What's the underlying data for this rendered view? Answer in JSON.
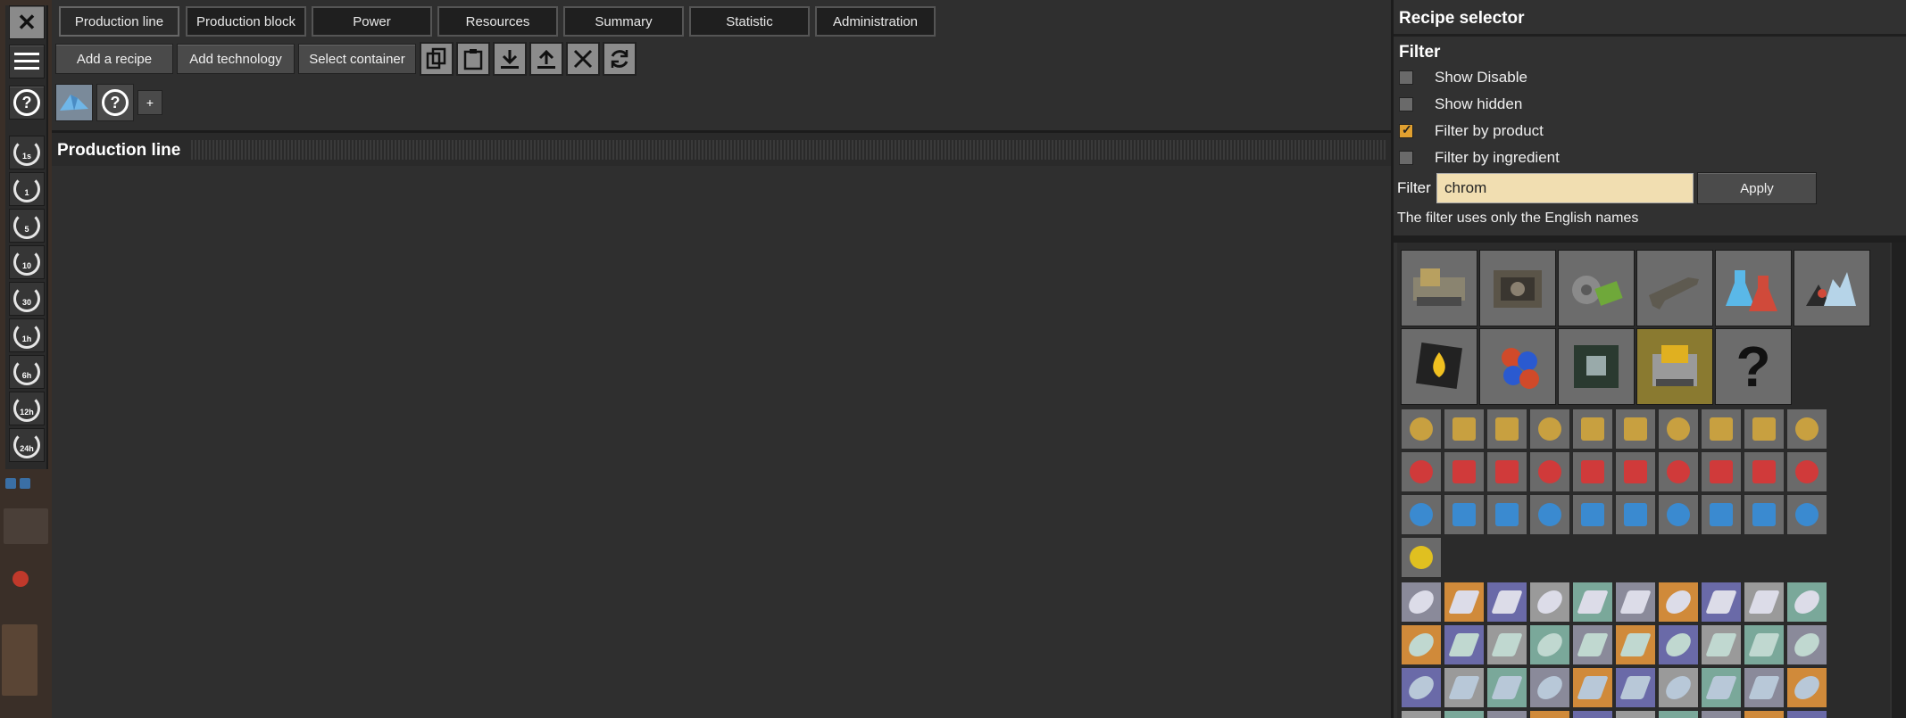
{
  "toolstrip": {
    "close_icon": "close-icon",
    "menu_icon": "menu-icon",
    "help_symbol": "?",
    "time_buttons": [
      "1s",
      "1",
      "5",
      "10",
      "30",
      "1h",
      "6h",
      "12h",
      "24h"
    ]
  },
  "tabs": [
    "Production line",
    "Production block",
    "Power",
    "Resources",
    "Summary",
    "Statistic",
    "Administration"
  ],
  "actions": {
    "add_recipe": "Add a recipe",
    "add_technology": "Add technology",
    "select_container": "Select container"
  },
  "toolbar_icons": [
    "copy-icon",
    "paste-icon",
    "download-icon",
    "upload-icon",
    "delete-icon",
    "refresh-icon"
  ],
  "chips": {
    "help_symbol": "?",
    "add_symbol": "+"
  },
  "production_line": {
    "title": "Production line"
  },
  "recipe_selector": {
    "title": "Recipe selector",
    "filter_heading": "Filter",
    "options": [
      {
        "label": "Show Disable",
        "checked": false
      },
      {
        "label": "Show hidden",
        "checked": false
      },
      {
        "label": "Filter by product",
        "checked": true
      },
      {
        "label": "Filter by ingredient",
        "checked": false
      }
    ],
    "filter_label": "Filter",
    "filter_value": "chrom",
    "apply_label": "Apply",
    "note": "The filter uses only the English names",
    "groups": [
      "logistics",
      "production",
      "intermediate-products",
      "combat",
      "science",
      "resources",
      "fluids",
      "particles",
      "circuits",
      "factory",
      "unknown"
    ],
    "unknown_symbol": "?"
  },
  "colors": {
    "accent_yellow": "#e0a030",
    "input_bg": "#f1deb1",
    "panel_bg": "#313131"
  }
}
